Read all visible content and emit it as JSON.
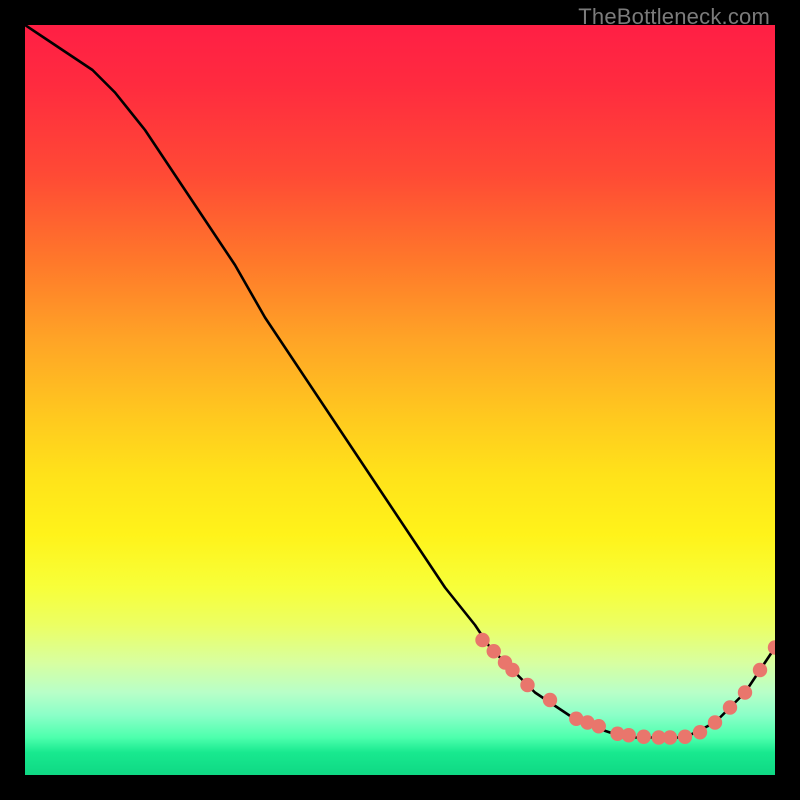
{
  "watermark": "TheBottleneck.com",
  "colors": {
    "line": "#000000",
    "marker_fill": "#e9766c",
    "marker_stroke": "#c74f47"
  },
  "chart_data": {
    "type": "line",
    "title": "",
    "xlabel": "",
    "ylabel": "",
    "xlim": [
      0,
      100
    ],
    "ylim": [
      0,
      100
    ],
    "series": [
      {
        "name": "curve",
        "x": [
          0,
          3,
          6,
          9,
          12,
          16,
          20,
          24,
          28,
          32,
          36,
          40,
          44,
          48,
          52,
          56,
          60,
          62,
          65,
          68,
          71,
          74,
          77,
          80,
          83,
          86,
          88,
          90,
          92,
          94,
          96,
          98,
          100
        ],
        "y": [
          100,
          98,
          96,
          94,
          91,
          86,
          80,
          74,
          68,
          61,
          55,
          49,
          43,
          37,
          31,
          25,
          20,
          17,
          14,
          11,
          9,
          7,
          6,
          5,
          5,
          5,
          5,
          6,
          7,
          9,
          11,
          14,
          17
        ]
      }
    ],
    "markers": {
      "name": "highlight-points",
      "x": [
        61,
        62.5,
        64,
        65,
        67,
        70,
        73.5,
        75,
        76.5,
        79,
        80.5,
        82.5,
        84.5,
        86,
        88,
        90,
        92,
        94,
        96,
        98,
        100
      ],
      "y": [
        18,
        16.5,
        15,
        14,
        12,
        10,
        7.5,
        7,
        6.5,
        5.5,
        5.3,
        5.1,
        5,
        5,
        5.1,
        5.7,
        7,
        9,
        11,
        14,
        17
      ]
    }
  }
}
